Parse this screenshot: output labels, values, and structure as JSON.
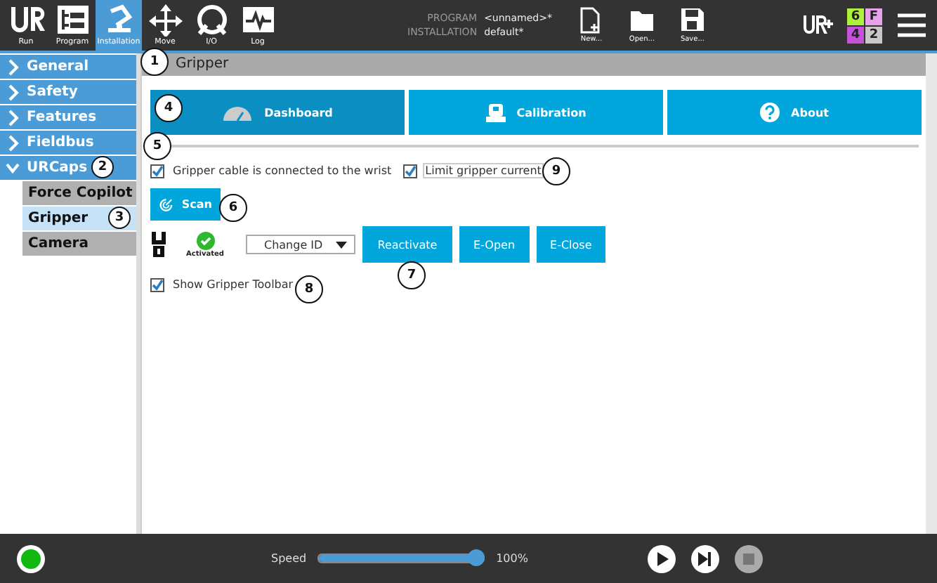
{
  "toolbar": {
    "apps": [
      {
        "kind": "run",
        "label": "Run",
        "selected": false
      },
      {
        "kind": "program",
        "label": "Program",
        "selected": false
      },
      {
        "kind": "installation",
        "label": "Installation",
        "selected": true
      },
      {
        "kind": "move",
        "label": "Move",
        "selected": false
      },
      {
        "kind": "io",
        "label": "I/O",
        "selected": false
      },
      {
        "kind": "log",
        "label": "Log",
        "selected": false
      }
    ],
    "program_label": "PROGRAM",
    "program_value": "<unnamed>*",
    "installation_label": "INSTALLATION",
    "installation_value": "default*",
    "file_actions": [
      {
        "kind": "new",
        "label": "New..."
      },
      {
        "kind": "open",
        "label": "Open..."
      },
      {
        "kind": "save",
        "label": "Save..."
      }
    ],
    "status_grid": [
      {
        "text": "6",
        "color": "#aef03c"
      },
      {
        "text": "F",
        "color": "#e8a2ea"
      },
      {
        "text": "4",
        "color": "#c452da"
      },
      {
        "text": "2",
        "color": "#c8c8c8"
      }
    ]
  },
  "sidebar": {
    "items": [
      {
        "label": "General",
        "expanded": false
      },
      {
        "label": "Safety",
        "expanded": false
      },
      {
        "label": "Features",
        "expanded": false
      },
      {
        "label": "Fieldbus",
        "expanded": false
      },
      {
        "label": "URCaps",
        "expanded": true,
        "children": [
          {
            "label": "Force Copilot",
            "selected": false
          },
          {
            "label": "Gripper",
            "selected": true
          },
          {
            "label": "Camera",
            "selected": false
          }
        ]
      }
    ]
  },
  "panel": {
    "title": "Gripper",
    "tabs": [
      {
        "kind": "dashboard",
        "label": "Dashboard",
        "selected": true
      },
      {
        "kind": "calibration",
        "label": "Calibration",
        "selected": false
      },
      {
        "kind": "about",
        "label": "About",
        "selected": false
      }
    ],
    "options": [
      {
        "label": "Gripper cable is connected to the wrist",
        "checked": true,
        "focused": false
      },
      {
        "label": "Limit gripper current",
        "checked": true,
        "focused": true
      }
    ],
    "scan_button": "Scan",
    "status": "Activated",
    "change_id": "Change ID",
    "buttons": [
      "Reactivate",
      "E-Open",
      "E-Close"
    ],
    "toolbar_option": {
      "label": "Show Gripper Toolbar",
      "checked": true
    }
  },
  "callouts": [
    "1",
    "2",
    "3",
    "4",
    "5",
    "6",
    "7",
    "8",
    "9"
  ],
  "footer": {
    "speed_label": "Speed",
    "speed": {
      "level": 1
    },
    "speed_reading": "100%",
    "controls": [
      {
        "kind": "play",
        "disabled": false
      },
      {
        "kind": "step",
        "disabled": false
      },
      {
        "kind": "stop",
        "disabled": true
      }
    ]
  }
}
